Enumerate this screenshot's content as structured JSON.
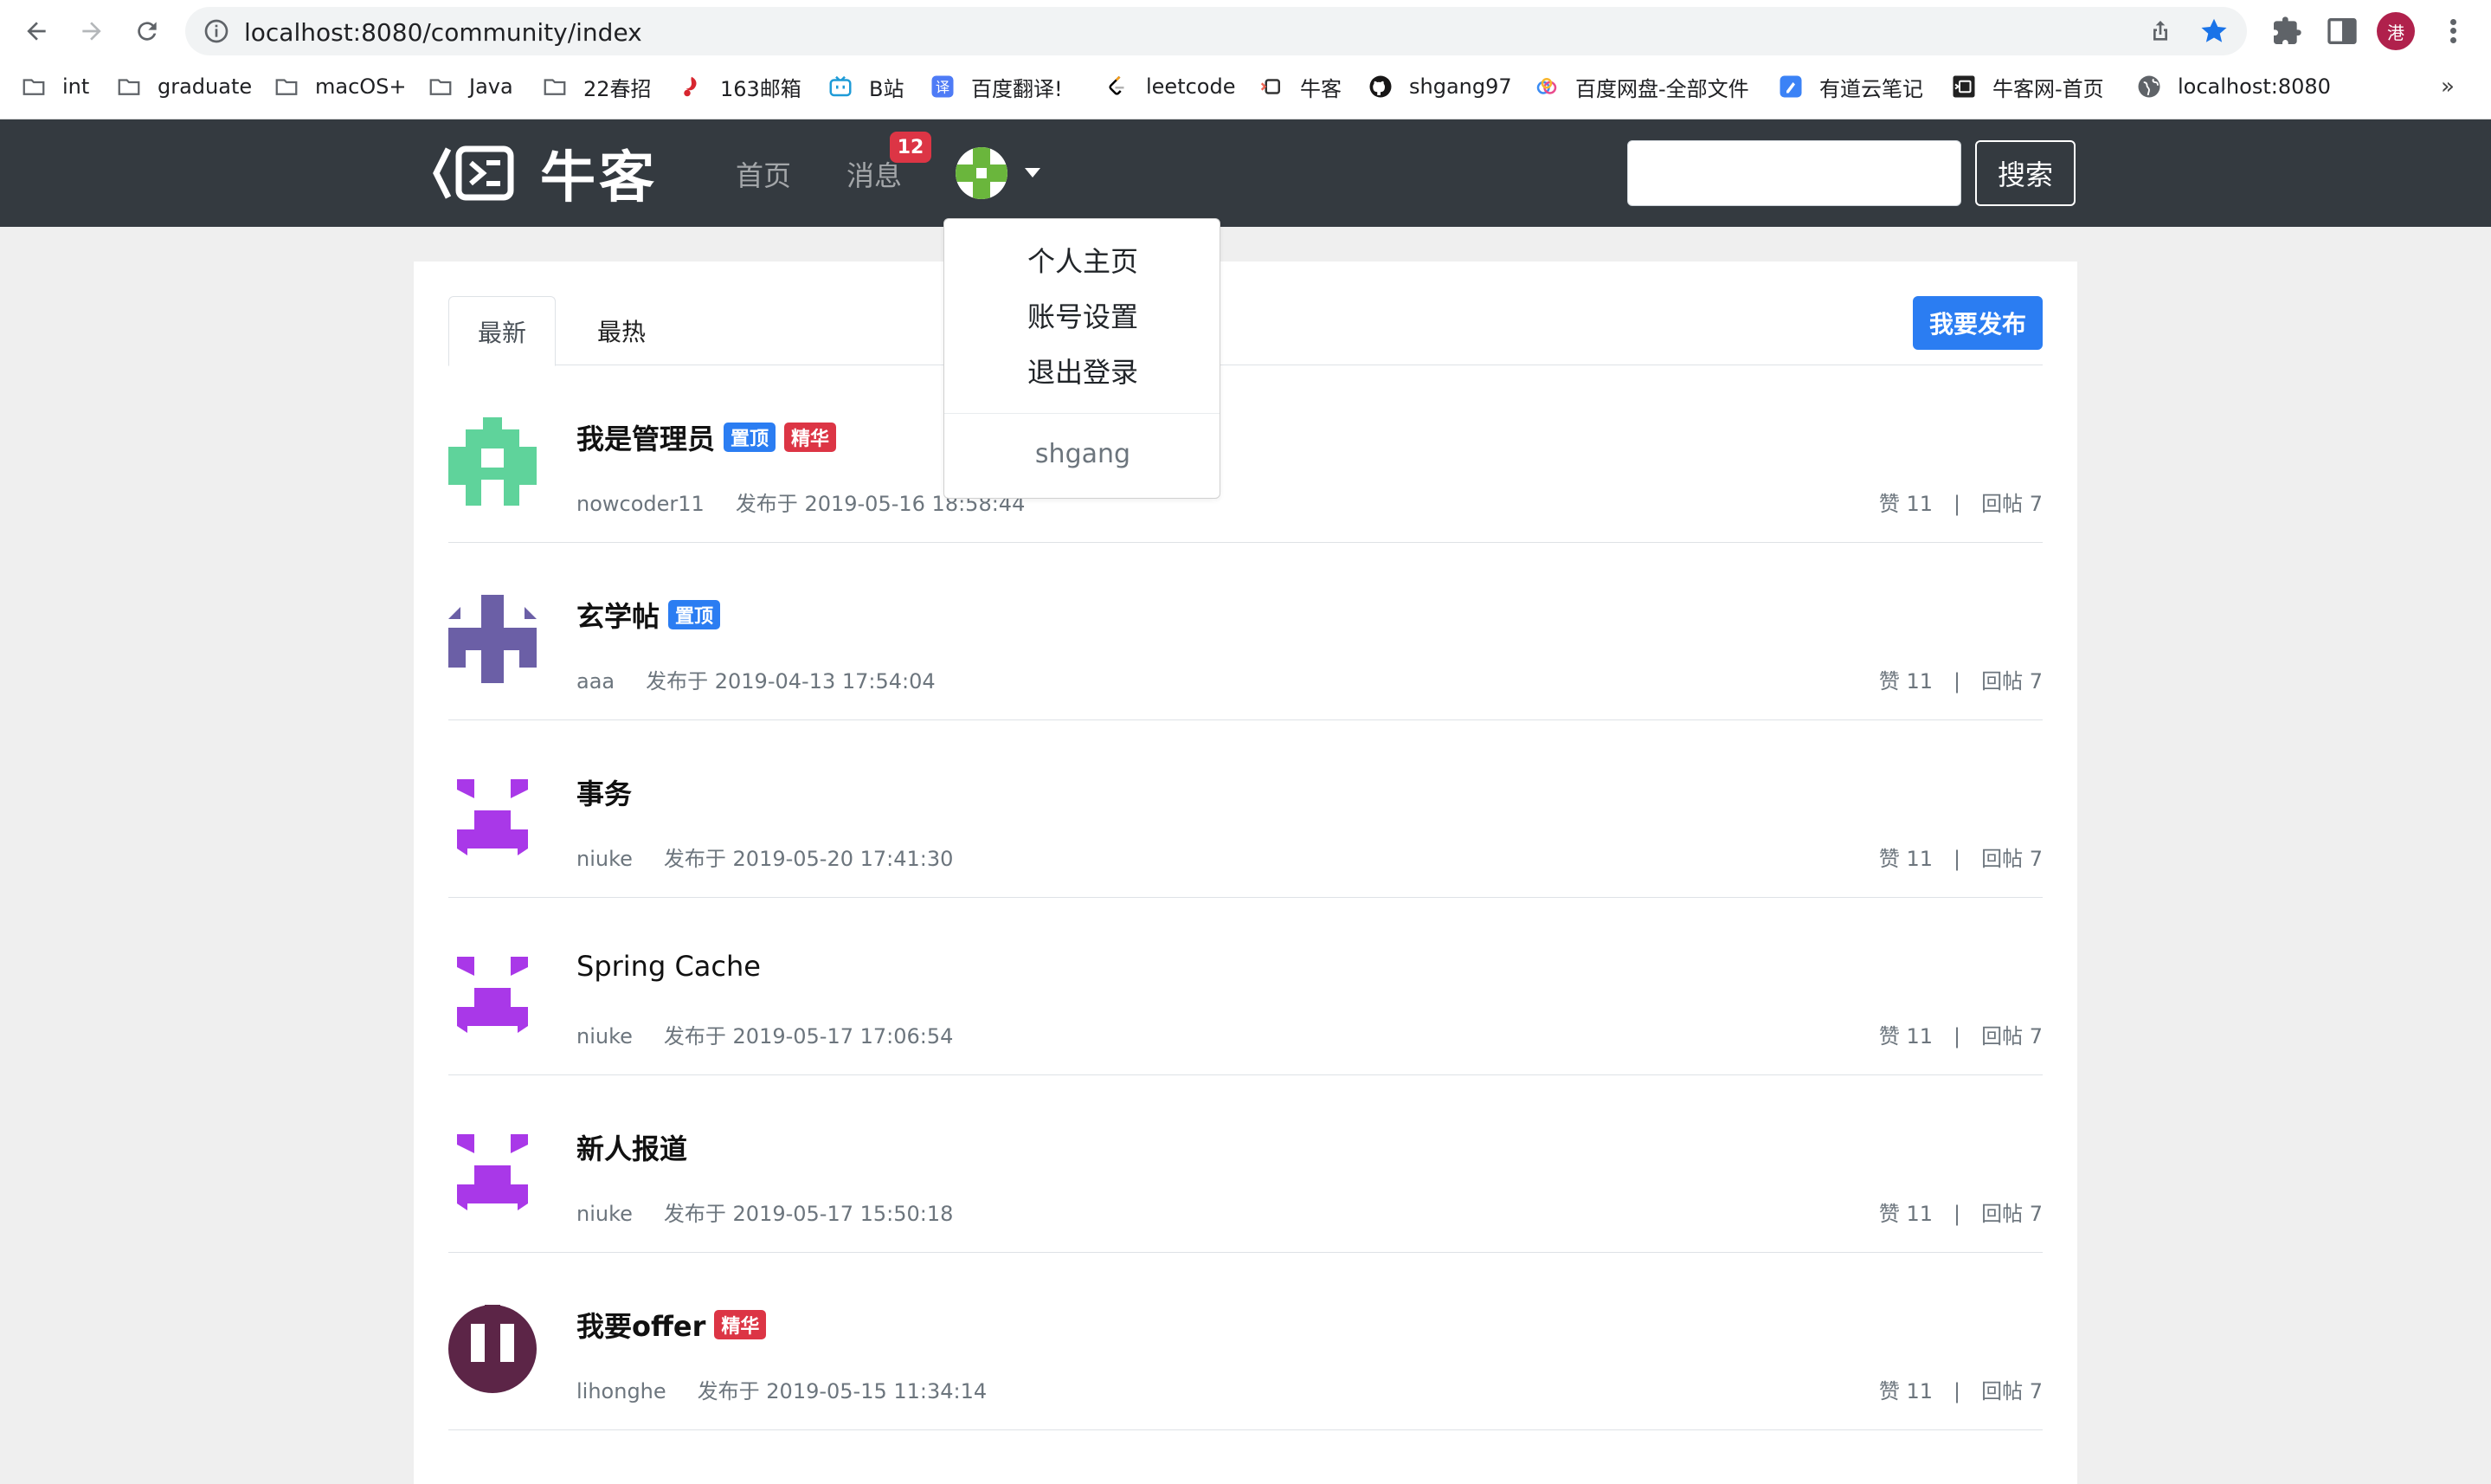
{
  "browser": {
    "url": "localhost:8080/community/index",
    "profile_initial": "港",
    "more_bookmarks": "»",
    "bookmarks": [
      {
        "label": "int",
        "icon": "folder-icon"
      },
      {
        "label": "graduate",
        "icon": "folder-icon"
      },
      {
        "label": "macOS+",
        "icon": "folder-icon"
      },
      {
        "label": "Java",
        "icon": "folder-icon"
      },
      {
        "label": "22春招",
        "icon": "folder-icon"
      },
      {
        "label": "163邮箱",
        "icon": "netease-mail-icon"
      },
      {
        "label": "B站",
        "icon": "bilibili-icon"
      },
      {
        "label": "百度翻译!",
        "icon": "baidu-translate-icon"
      },
      {
        "label": "leetcode",
        "icon": "leetcode-icon"
      },
      {
        "label": "牛客",
        "icon": "nowcoder-icon"
      },
      {
        "label": "shgang97",
        "icon": "github-icon"
      },
      {
        "label": "百度网盘-全部文件",
        "icon": "baidu-netdisk-icon"
      },
      {
        "label": "有道云笔记",
        "icon": "youdao-note-icon"
      },
      {
        "label": "牛客网-首页",
        "icon": "nowcoder-home-icon"
      },
      {
        "label": "localhost:8080",
        "icon": "globe-icon"
      }
    ]
  },
  "navbar": {
    "logo_text": "牛客",
    "home": "首页",
    "messages": "消息",
    "message_count": "12",
    "search_placeholder": "",
    "search_button": "搜索"
  },
  "dropdown": {
    "items": [
      "个人主页",
      "账号设置",
      "退出登录"
    ],
    "username": "shgang"
  },
  "tabs": [
    "最新",
    "最热"
  ],
  "publish_button": "我要发布",
  "posts": [
    {
      "title": "我是管理员",
      "tags": [
        "置顶",
        "精华"
      ],
      "author": "nowcoder11",
      "date": "发布于 2019-05-16 18:58:44",
      "likes": "赞 11",
      "replies": "回帖 7"
    },
    {
      "title": "玄学帖",
      "tags": [
        "置顶"
      ],
      "author": "aaa",
      "date": "发布于 2019-04-13 17:54:04",
      "likes": "赞 11",
      "replies": "回帖 7"
    },
    {
      "title": "事务",
      "tags": [],
      "author": "niuke",
      "date": "发布于 2019-05-20 17:41:30",
      "likes": "赞 11",
      "replies": "回帖 7"
    },
    {
      "title": "Spring Cache",
      "tags": [],
      "author": "niuke",
      "date": "发布于 2019-05-17 17:06:54",
      "likes": "赞 11",
      "replies": "回帖 7"
    },
    {
      "title": "新人报道",
      "tags": [],
      "author": "niuke",
      "date": "发布于 2019-05-17 15:50:18",
      "likes": "赞 11",
      "replies": "回帖 7"
    },
    {
      "title": "我要offer",
      "tags": [
        "精华"
      ],
      "author": "lihonghe",
      "date": "发布于 2019-05-15 11:34:14",
      "likes": "赞 11",
      "replies": "回帖 7"
    }
  ],
  "separator": "|",
  "colors": {
    "navbar": "#343a40",
    "primary": "#2b7df2",
    "danger": "#dc3545"
  }
}
